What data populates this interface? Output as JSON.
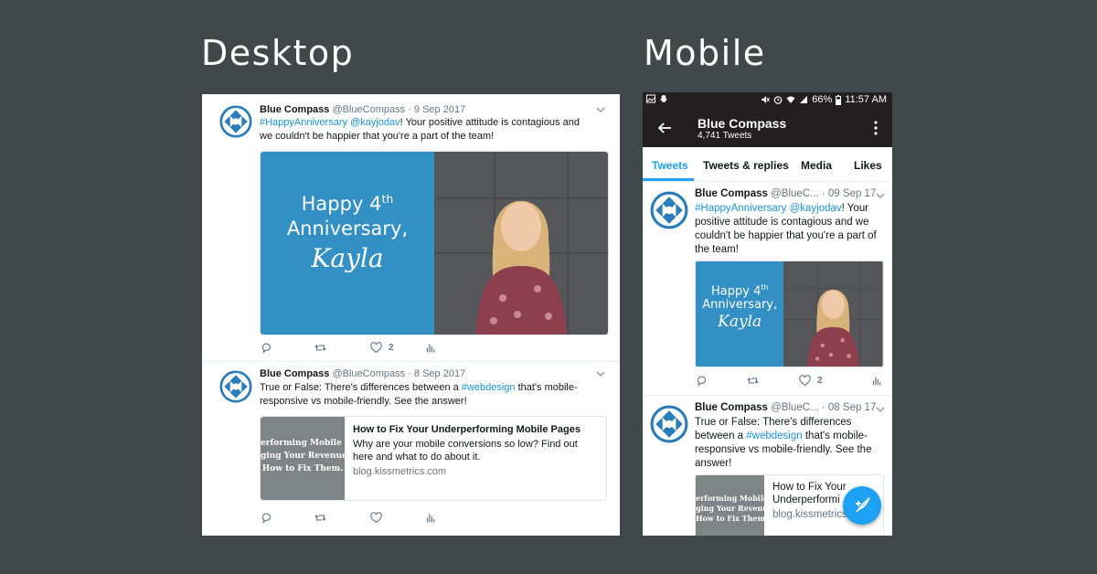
{
  "headings": {
    "desktop": "Desktop",
    "mobile": "Mobile"
  },
  "colors": {
    "background": "#414849",
    "brand_blue": "#3390c5",
    "link": "#1b95e0",
    "twitter_blue": "#1da1f2",
    "android_bar": "#231e1f"
  },
  "desktop": {
    "tweets": [
      {
        "name": "Blue Compass",
        "handle": "@BlueCompass",
        "date": "· 9 Sep 2017",
        "hashtag": "#HappyAnniversary",
        "mention": "@kayjodav",
        "text_rest": "! Your positive attitude is contagious and we couldn't be happier that you're a part of the team!",
        "image_text": {
          "line1": "Happy 4",
          "sup": "th",
          "line2": "Anniversary,",
          "script": "Kayla"
        },
        "likes": "2"
      },
      {
        "name": "Blue Compass",
        "handle": "@BlueCompass",
        "date": "· 8 Sep 2017",
        "text_before": "True or False: There's differences between a ",
        "hashtag": "#webdesign",
        "text_after": " that's mobile-responsive vs mobile-friendly. See the answer!",
        "card": {
          "thumb_lines": [
            "erforming Mobile Pa",
            "ging Your Revenue.",
            "How to Fix Them."
          ],
          "title": "How to Fix Your Underperforming Mobile Pages",
          "description": "Why are your mobile conversions so low? Find out here and what to do about it.",
          "url": "blog.kissmetrics.com"
        }
      }
    ]
  },
  "mobile": {
    "status": {
      "battery": "66%",
      "time": "11:57 AM"
    },
    "appbar": {
      "name": "Blue Compass",
      "count": "4,741 Tweets"
    },
    "tabs": [
      "Tweets",
      "Tweets & replies",
      "Media",
      "Likes"
    ],
    "active_tab": "Tweets",
    "tweets": [
      {
        "name": "Blue Compass",
        "handle": "@BlueC...",
        "date": "· 09 Sep 17",
        "hashtag": "#HappyAnniversary",
        "mention": "@kayjodav",
        "text_rest": "! Your positive attitude is contagious and we couldn't be happier that you're a part of the team!",
        "image_text": {
          "line1": "Happy 4",
          "sup": "th",
          "line2": "Anniversary,",
          "script": "Kayla"
        },
        "likes": "2"
      },
      {
        "name": "Blue Compass",
        "handle": "@BlueC...",
        "date": "· 08 Sep 17",
        "text_before": "True or False: There's differences between a ",
        "hashtag": "#webdesign",
        "text_after": " that's mobile-responsive vs mobile-friendly. See the answer!",
        "card": {
          "thumb_lines": [
            "erforming Mobile Pa",
            "ging Your Revenue.",
            "How to Fix Them."
          ],
          "title": "How to Fix Your Underperformi",
          "url": "blog.kissmetrics.com"
        }
      }
    ]
  }
}
